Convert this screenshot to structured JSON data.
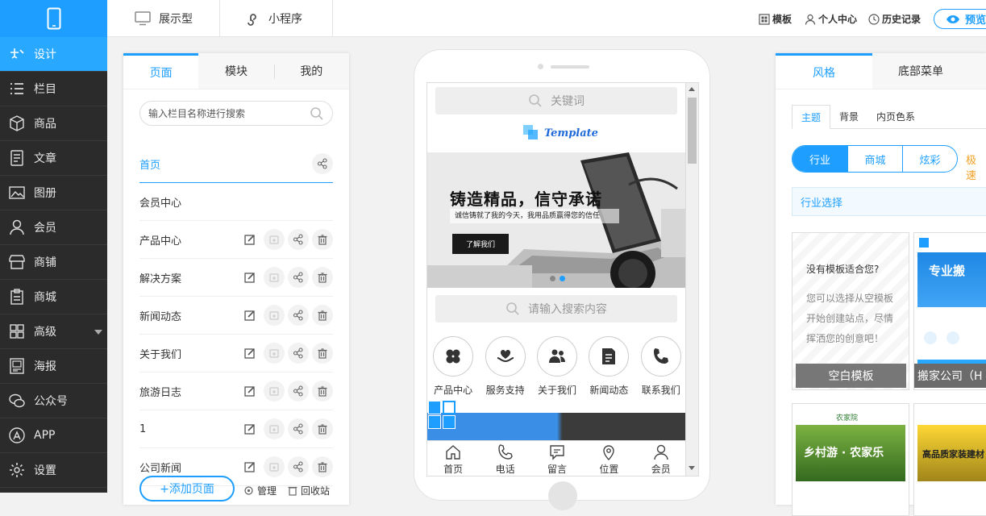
{
  "nav": {
    "items": [
      {
        "label": "设计",
        "icon": "pen-ruler-icon",
        "active": true
      },
      {
        "label": "栏目",
        "icon": "list-icon"
      },
      {
        "label": "商品",
        "icon": "box-icon"
      },
      {
        "label": "文章",
        "icon": "article-icon"
      },
      {
        "label": "图册",
        "icon": "picture-icon"
      },
      {
        "label": "会员",
        "icon": "user-icon"
      },
      {
        "label": "商铺",
        "icon": "store-icon"
      },
      {
        "label": "商城",
        "icon": "clipboard-icon"
      },
      {
        "label": "高级",
        "icon": "grid-icon"
      },
      {
        "label": "海报",
        "icon": "poster-icon"
      },
      {
        "label": "公众号",
        "icon": "wechat-icon"
      },
      {
        "label": "APP",
        "icon": "app-store-icon"
      },
      {
        "label": "设置",
        "icon": "gear-icon"
      }
    ]
  },
  "topbar": {
    "tab_display": "展示型",
    "tab_miniapp": "小程序",
    "template_link": "模板",
    "personal_link": "个人中心",
    "history_link": "历史记录",
    "preview_label": "预览"
  },
  "pages_panel": {
    "tabs": [
      "页面",
      "模块",
      "我的"
    ],
    "search_placeholder": "输入栏目名称进行搜索",
    "items": [
      "首页",
      "会员中心",
      "产品中心",
      "解决方案",
      "新闻动态",
      "关于我们",
      "旅游日志",
      "1",
      "公司新闻"
    ],
    "add_page": "+添加页面",
    "manage": "管理",
    "recycle": "回收站"
  },
  "mobile": {
    "top_search": "关键词",
    "logo_text": "Template",
    "banner_title": "铸造精品，信守承诺",
    "banner_sub": "诚信铸就了我的今天，我用品质赢得您的信任",
    "banner_button": "了解我们",
    "content_search": "请输入搜索内容",
    "quick_links": [
      {
        "label": "产品中心",
        "icon": "clover-icon"
      },
      {
        "label": "服务支持",
        "icon": "heart-hand-icon"
      },
      {
        "label": "关于我们",
        "icon": "people-icon"
      },
      {
        "label": "新闻动态",
        "icon": "document-icon"
      },
      {
        "label": "联系我们",
        "icon": "phone-icon"
      }
    ],
    "tabbar": [
      {
        "label": "首页",
        "icon": "home-icon"
      },
      {
        "label": "电话",
        "icon": "phone-icon"
      },
      {
        "label": "留言",
        "icon": "message-icon"
      },
      {
        "label": "位置",
        "icon": "location-icon"
      },
      {
        "label": "会员",
        "icon": "user-icon"
      }
    ]
  },
  "style_panel": {
    "tabs": [
      "风格",
      "底部菜单"
    ],
    "subtabs": [
      "主题",
      "背景",
      "内页色系"
    ],
    "segments": [
      "行业",
      "商城",
      "炫彩"
    ],
    "extra": "极速",
    "industry_select": "行业选择",
    "blank_card": {
      "question": "没有模板适合您?",
      "desc_line1": "您可以选择从空模板",
      "desc_line2": "开始创建站点，尽情",
      "desc_line3": "挥洒您的创意吧！",
      "caption": "空白模板"
    },
    "template_card1": {
      "banner_text": "专业搬",
      "caption": "搬家公司（H"
    },
    "template_card2": {
      "banner_text": "乡村游 · 农家乐",
      "logo": "农家院"
    },
    "template_card3": {
      "banner_text": "高品质家装建材"
    }
  },
  "colors": {
    "accent": "#1e9fff",
    "nav_bg": "#2b2b2b",
    "nav_active": "#29a8ff"
  }
}
